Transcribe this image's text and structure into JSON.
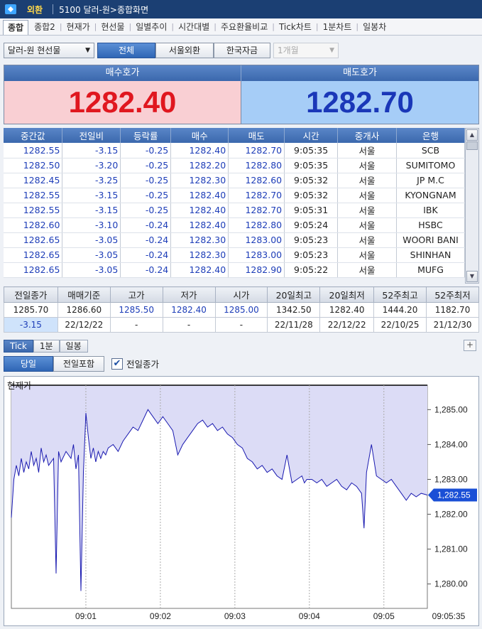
{
  "app": {
    "category": "외환",
    "window_title": "5100 달러-원>종합화면"
  },
  "tabs": [
    "종합",
    "종합2",
    "현재가",
    "현선물",
    "일별추이",
    "시간대별",
    "주요환율비교",
    "Tick차트",
    "1분차트",
    "일봉차"
  ],
  "toolbar": {
    "instrument": "달러-원 현선물",
    "filters": [
      "전체",
      "서울외환",
      "한국자금"
    ],
    "period": "1개월"
  },
  "quotes": {
    "bid_label": "매수호가",
    "bid_value": "1282.40",
    "ask_label": "매도호가",
    "ask_value": "1282.70"
  },
  "ticks": {
    "columns": [
      "중간값",
      "전일비",
      "등락률",
      "매수",
      "매도",
      "시간",
      "중개사",
      "은행"
    ],
    "rows": [
      [
        "1282.55",
        "-3.15",
        "-0.25",
        "1282.40",
        "1282.70",
        "9:05:35",
        "서울",
        "SCB"
      ],
      [
        "1282.50",
        "-3.20",
        "-0.25",
        "1282.20",
        "1282.80",
        "9:05:35",
        "서울",
        "SUMITOMO"
      ],
      [
        "1282.45",
        "-3.25",
        "-0.25",
        "1282.30",
        "1282.60",
        "9:05:32",
        "서울",
        "JP M.C"
      ],
      [
        "1282.55",
        "-3.15",
        "-0.25",
        "1282.40",
        "1282.70",
        "9:05:32",
        "서울",
        "KYONGNAM"
      ],
      [
        "1282.55",
        "-3.15",
        "-0.25",
        "1282.40",
        "1282.70",
        "9:05:31",
        "서울",
        "IBK"
      ],
      [
        "1282.60",
        "-3.10",
        "-0.24",
        "1282.40",
        "1282.80",
        "9:05:24",
        "서울",
        "HSBC"
      ],
      [
        "1282.65",
        "-3.05",
        "-0.24",
        "1282.30",
        "1283.00",
        "9:05:23",
        "서울",
        "WOORI BANI"
      ],
      [
        "1282.65",
        "-3.05",
        "-0.24",
        "1282.30",
        "1283.00",
        "9:05:23",
        "서울",
        "SHINHAN"
      ],
      [
        "1282.65",
        "-3.05",
        "-0.24",
        "1282.40",
        "1282.90",
        "9:05:22",
        "서울",
        "MUFG"
      ]
    ]
  },
  "summary": {
    "headers": [
      "전일종가",
      "매매기준",
      "고가",
      "저가",
      "시가",
      "20일최고",
      "20일최저",
      "52주최고",
      "52주최저"
    ],
    "values": [
      "1285.70",
      "1286.60",
      "1285.50",
      "1282.40",
      "1285.00",
      "1342.50",
      "1282.40",
      "1444.20",
      "1182.70"
    ],
    "dates": [
      "-3.15",
      "22/12/22",
      "-",
      "-",
      "-",
      "22/11/28",
      "22/12/22",
      "22/10/25",
      "21/12/30"
    ]
  },
  "chart_tabs": [
    "Tick",
    "1분",
    "일봉"
  ],
  "chart_controls": {
    "today": "당일",
    "include_prev": "전일포함",
    "prev_close_label": "전일종가",
    "prev_close_checked": "✔"
  },
  "colors": {
    "bid_bg": "#f9cfd3",
    "bid_text": "#e0171f",
    "ask_bg": "#a6cdf7",
    "ask_text": "#1a37b8",
    "chart_fill": "#dcdcf6",
    "chart_line": "#1a1ab0",
    "current_tag": "#1a4fd6"
  },
  "chart_data": {
    "type": "line",
    "title": "현재가",
    "y_ticks": [
      "1,285.00",
      "1,284.00",
      "1,283.00",
      "1,282.00",
      "1,281.00",
      "1,280.00"
    ],
    "y_tick_values": [
      1285,
      1284,
      1283,
      1282,
      1281,
      1280
    ],
    "x_ticks": [
      "09:01",
      "09:02",
      "09:03",
      "09:04",
      "09:05"
    ],
    "x_tick_seconds": [
      60,
      120,
      180,
      240,
      300
    ],
    "x_end_label": "09:05:35",
    "ylim": [
      1279.3,
      1285.7
    ],
    "xlim": [
      0,
      335
    ],
    "prev_close": 1285.7,
    "current_label": "1,282.55",
    "current_value": 1282.55,
    "x": [
      0,
      2,
      4,
      6,
      8,
      10,
      12,
      14,
      16,
      18,
      20,
      22,
      24,
      26,
      28,
      30,
      34,
      36,
      38,
      40,
      44,
      48,
      50,
      52,
      54,
      56,
      58,
      60,
      62,
      64,
      66,
      68,
      70,
      72,
      74,
      76,
      78,
      82,
      86,
      90,
      94,
      98,
      102,
      106,
      110,
      114,
      118,
      122,
      126,
      130,
      134,
      138,
      142,
      146,
      150,
      154,
      158,
      162,
      166,
      170,
      174,
      178,
      182,
      186,
      190,
      194,
      198,
      202,
      206,
      210,
      214,
      218,
      222,
      226,
      230,
      234,
      236,
      238,
      240,
      242,
      246,
      250,
      254,
      258,
      262,
      266,
      270,
      274,
      278,
      280,
      282,
      284,
      286,
      290,
      294,
      298,
      302,
      306,
      310,
      314,
      318,
      322,
      326,
      330,
      335
    ],
    "y": [
      1281.9,
      1283.0,
      1283.4,
      1283.1,
      1283.6,
      1283.2,
      1283.5,
      1283.3,
      1283.8,
      1283.4,
      1283.6,
      1283.2,
      1283.9,
      1283.5,
      1283.7,
      1283.4,
      1283.6,
      1280.3,
      1283.8,
      1283.5,
      1283.8,
      1283.6,
      1284.0,
      1283.3,
      1283.7,
      1279.8,
      1283.2,
      1284.9,
      1284.2,
      1283.6,
      1283.9,
      1283.5,
      1283.8,
      1283.6,
      1283.8,
      1283.7,
      1283.9,
      1284.0,
      1283.8,
      1284.1,
      1284.3,
      1284.5,
      1284.4,
      1284.7,
      1285.0,
      1284.8,
      1284.6,
      1284.8,
      1284.6,
      1284.4,
      1283.7,
      1284.0,
      1284.2,
      1284.4,
      1284.6,
      1284.7,
      1284.5,
      1284.6,
      1284.4,
      1284.5,
      1284.3,
      1284.2,
      1284.0,
      1283.9,
      1283.6,
      1283.5,
      1283.3,
      1283.4,
      1283.2,
      1283.3,
      1283.1,
      1283.0,
      1283.7,
      1282.9,
      1283.0,
      1283.1,
      1282.9,
      1283.0,
      1283.0,
      1283.0,
      1282.9,
      1283.0,
      1282.8,
      1282.9,
      1283.0,
      1282.8,
      1282.7,
      1282.9,
      1282.8,
      1282.7,
      1282.6,
      1281.6,
      1283.2,
      1284.0,
      1283.1,
      1283.0,
      1282.9,
      1283.0,
      1282.8,
      1282.6,
      1282.4,
      1282.6,
      1282.5,
      1282.6,
      1282.55
    ]
  }
}
